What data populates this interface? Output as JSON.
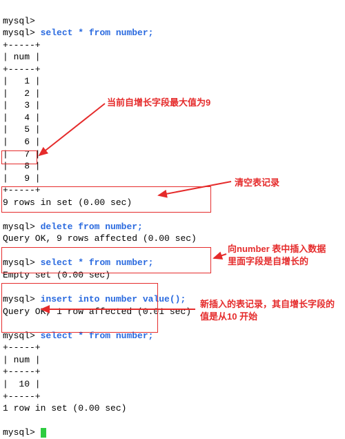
{
  "prompt": "mysql>",
  "queries": {
    "select1": "select * from number;",
    "delete": "delete from number;",
    "select2": "select * from number;",
    "insert": "insert into number value();",
    "select3": "select * from number;"
  },
  "table_border": "+-----+",
  "header": "| num |",
  "initial_rows": [
    "|   1 |",
    "|   2 |",
    "|   3 |",
    "|   4 |",
    "|   5 |",
    "|   6 |",
    "|   7 |",
    "|   8 |"
  ],
  "initial_last_row": "|   9 |",
  "initial_result": "9 rows in set (0.00 sec)",
  "delete_result": "Query OK, 9 rows affected (0.00 sec)",
  "empty_result": "Empty set (0.00 sec)",
  "insert_result": "Query OK, 1 row affected (0.01 sec)",
  "final_row": "|  10 |",
  "final_result": "1 row in set (0.00 sec)",
  "annotations": {
    "max9": "当前自增长字段最大值为9",
    "clear": "清空表记录",
    "insert_line1": "向number 表中插入数据",
    "insert_line2": "里面字段是自增长的",
    "newrow_line1": "新插入的表记录，其自增长字段的",
    "newrow_line2": "值是从10 开始"
  }
}
